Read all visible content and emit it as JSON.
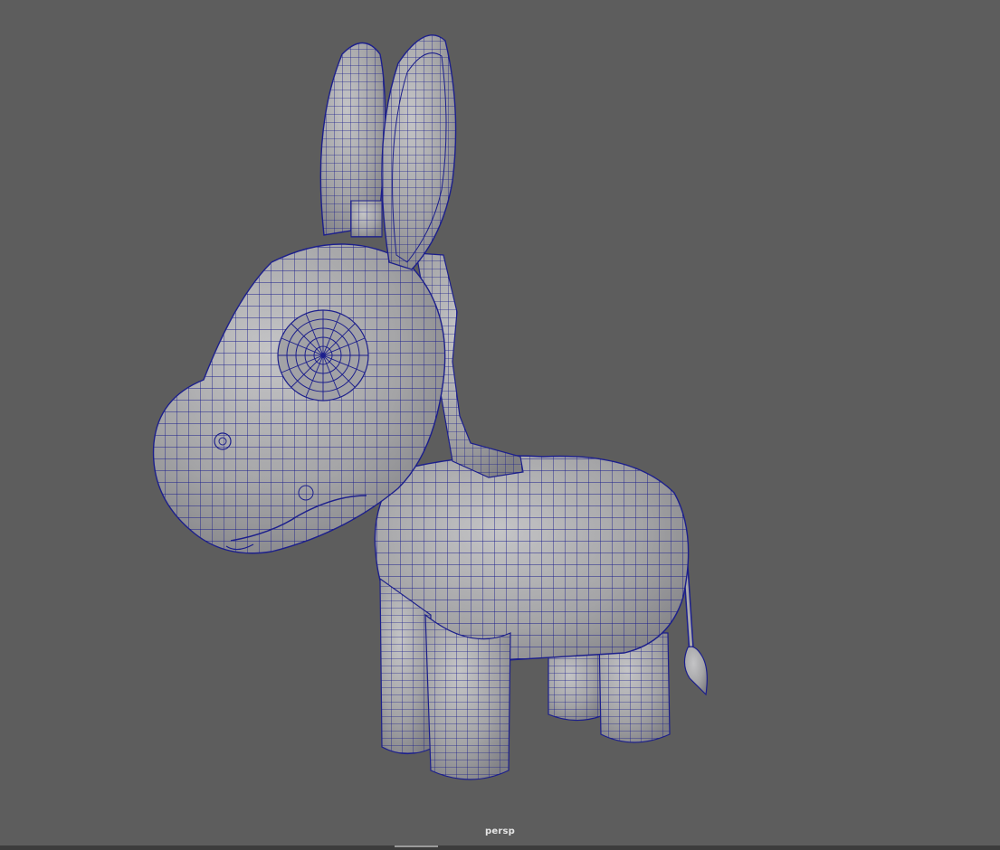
{
  "viewport": {
    "camera_name": "persp",
    "background_color": "#5d5d5d",
    "wireframe_color": "#1c1f8c",
    "shaded_color": "#a9a9ab"
  },
  "model": {
    "icon": "donkey-mesh"
  }
}
